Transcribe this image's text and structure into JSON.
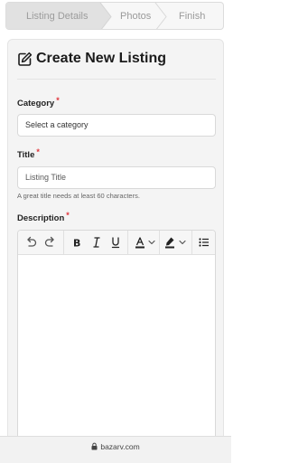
{
  "stepper": {
    "steps": [
      {
        "label": "Listing Details",
        "state": "active"
      },
      {
        "label": "Photos",
        "state": "inactive"
      },
      {
        "label": "Finish",
        "state": "inactive"
      }
    ]
  },
  "form": {
    "title": "Create New Listing",
    "title_icon": "edit-icon",
    "category": {
      "label": "Category",
      "required_mark": "*",
      "value": "Select a category"
    },
    "listing_title": {
      "label": "Title",
      "required_mark": "*",
      "placeholder": "Listing Title",
      "help": "A great title needs at least 60 characters."
    },
    "description": {
      "label": "Description",
      "required_mark": "*",
      "toolbar": [
        "undo-icon",
        "redo-icon",
        "bold",
        "italic",
        "underline",
        "font-color",
        "highlight-color",
        "bulleted-list-icon"
      ]
    }
  },
  "browser": {
    "url": "bazarv.com"
  },
  "colors": {
    "required": "#e0343b",
    "card_bg": "#f4f4f4",
    "active_step_bg": "#e2e2e2"
  }
}
